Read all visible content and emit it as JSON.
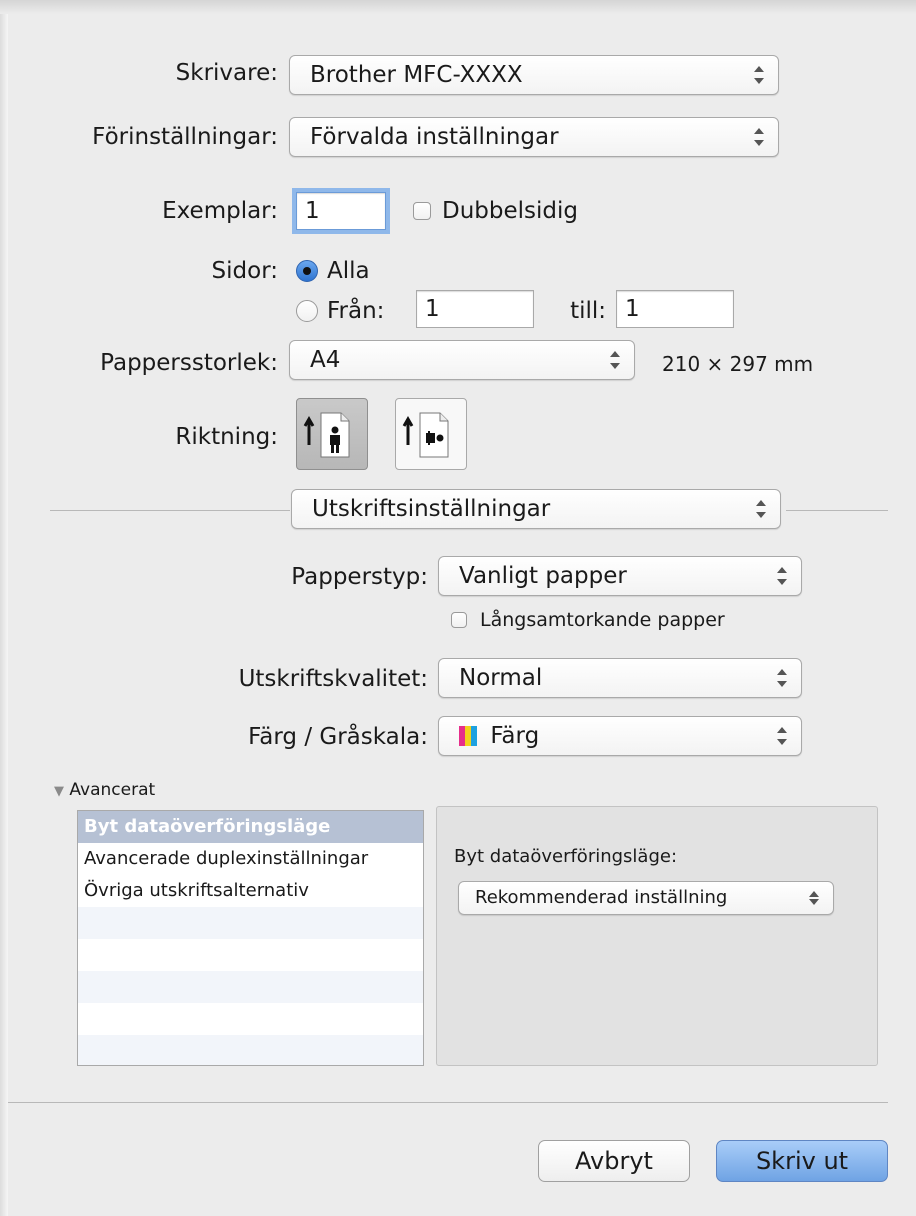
{
  "dialog": {
    "printer": {
      "label": "Skrivare:",
      "value": "Brother MFC-XXXX"
    },
    "presets": {
      "label": "Förinställningar:",
      "value": "Förvalda inställningar"
    },
    "copies": {
      "label": "Exemplar:",
      "value": "1"
    },
    "duplex": {
      "label": "Dubbelsidig",
      "checked": false
    },
    "pages": {
      "label": "Sidor:",
      "all_label": "Alla",
      "from_label": "Från:",
      "from_value": "1",
      "to_label": "till:",
      "to_value": "1",
      "selected": "Alla"
    },
    "paper_size": {
      "label": "Pappersstorlek:",
      "value": "A4",
      "dimensions": "210 × 297 mm"
    },
    "orientation": {
      "label": "Riktning:",
      "options": [
        "portrait-icon",
        "landscape-icon"
      ],
      "selected": "portrait-icon"
    },
    "section": {
      "value": "Utskriftsinställningar"
    },
    "media_type": {
      "label": "Papperstyp:",
      "value": "Vanligt papper"
    },
    "slow_drying": {
      "label": "Långsamtorkande papper",
      "checked": false
    },
    "quality": {
      "label": "Utskriftskvalitet:",
      "value": "Normal"
    },
    "color": {
      "label": "Färg / Gråskala:",
      "value": "Färg",
      "icon": "color-bars-icon",
      "swatch": [
        "#e62e8b",
        "#f2d21c",
        "#1da1e0"
      ]
    },
    "advanced": {
      "label": "Avancerat",
      "items": [
        "Byt dataöverföringsläge",
        "Avancerade duplexinställningar",
        "Övriga utskriftsalternativ"
      ],
      "selected_index": 0,
      "detail_label": "Byt dataöverföringsläge:",
      "detail_value": "Rekommenderad inställning"
    },
    "buttons": {
      "cancel": "Avbryt",
      "print": "Skriv ut"
    }
  }
}
